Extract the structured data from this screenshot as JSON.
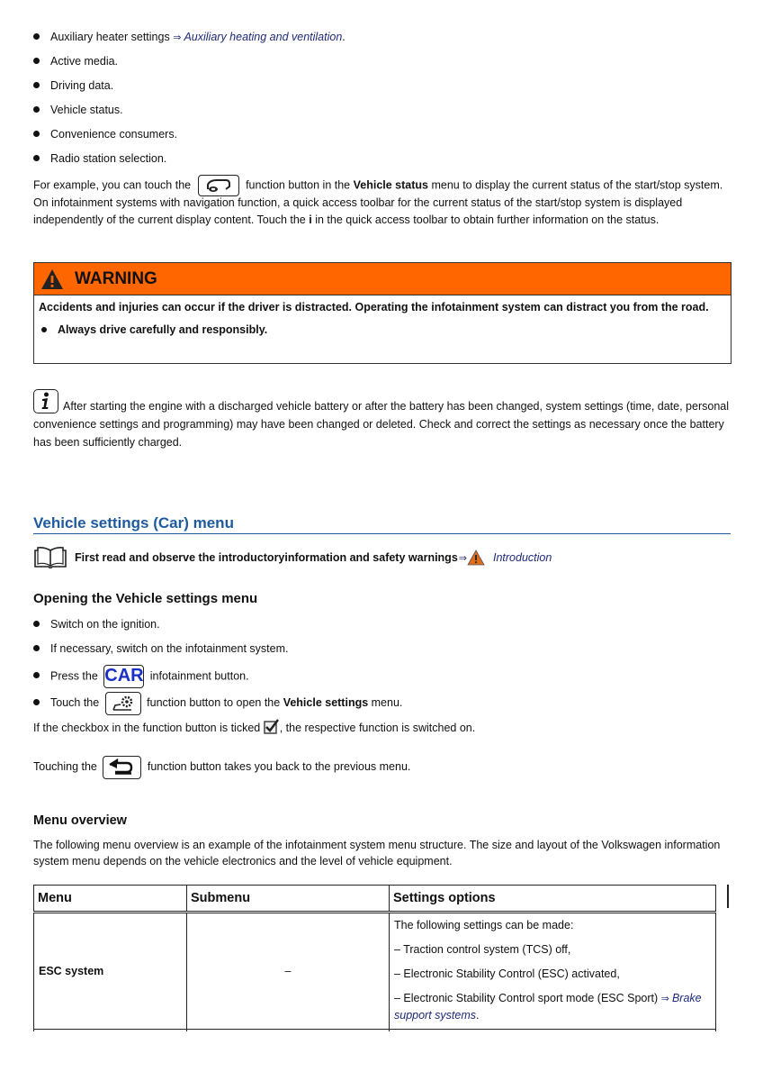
{
  "top_list": [
    {
      "text": "Auxiliary heater settings ",
      "link": "Auxiliary heating and ventilation",
      "suffix": "."
    },
    {
      "text": "Active media."
    },
    {
      "text": "Driving data."
    },
    {
      "text": "Vehicle status."
    },
    {
      "text": "Convenience consumers."
    },
    {
      "text": "Radio station selection."
    }
  ],
  "example_para": {
    "part1": "For example, you can touch the",
    "part2": " function button in the ",
    "bold": "Vehicle status",
    "part3": " menu to display the current status of the start/stop system.",
    "line2": "On infotainment systems with navigation function, a quick access toolbar for the current status of the start/stop system is displayed",
    "line3a": "independently of the current display content. Touch the ",
    "line3bold": "i",
    "line3b": " in the quick access toolbar to obtain further information on the status."
  },
  "warning": {
    "title": "WARNING",
    "body": "Accidents and injuries can occur if the driver is distracted. Operating the infotainment system can distract you from the road.",
    "bullet": "Always drive carefully and responsibly.",
    "header_color": "#ff6600"
  },
  "note": {
    "line1": "After starting the engine with a discharged vehicle battery or after the battery has been changed, system settings (time, date, personal",
    "line2": "convenience settings and programming) may have been changed or deleted. Check and correct the settings as necessary once the battery",
    "line3": "has been sufficiently charged."
  },
  "section": {
    "title": "Vehicle settings (Car) menu",
    "intro": "First read and observe the introductoryinformation and safety warnings",
    "intro_link": "Introduction"
  },
  "opening": {
    "heading": "Opening the Vehicle settings menu",
    "steps": [
      {
        "text": "Switch on the ignition."
      },
      {
        "text": "If necessary, switch on the infotainment system."
      },
      {
        "pre": "Press the",
        "post": " infotainment button.",
        "button": "CAR"
      },
      {
        "pre": "Touch the",
        "post_a": " function button to open the ",
        "bold": "Vehicle settings",
        "post_b": " menu."
      }
    ],
    "checkbox_a": "If the checkbox in the function button is ticked ",
    "checkbox_b": ", the respective function is switched on.",
    "back_a": "Touching the",
    "back_b": " function button takes you back to the previous menu."
  },
  "overview": {
    "heading": "Menu overview",
    "line1": "The following menu overview is an example of the infotainment system menu structure. The size and layout of the Volkswagen information",
    "line2": "system menu depends on the vehicle electronics and the level of vehicle equipment.",
    "table": {
      "headers": [
        "Menu",
        "Submenu",
        "Settings options"
      ],
      "rows": [
        {
          "menu": "ESC system",
          "submenu": "–",
          "options": [
            "The following settings can be made:",
            "– Traction control system (TCS) off,",
            "– Electronic Stability Control (ESC) activated,"
          ],
          "last_option": "– Electronic Stability Control sport mode (ESC Sport) ",
          "last_link": "Brake support systems",
          "last_suffix": "."
        }
      ]
    }
  }
}
